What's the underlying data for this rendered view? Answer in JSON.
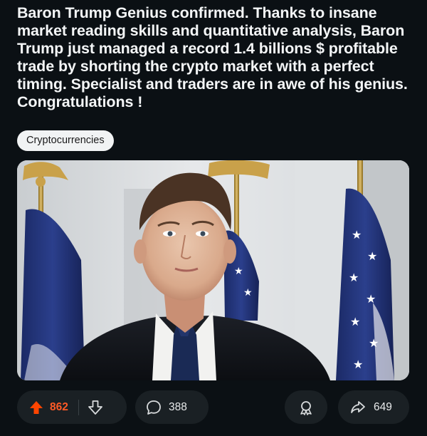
{
  "post": {
    "title": "Baron Trump Genius confirmed. Thanks to insane market reading skills and quantitative analysis, Baron Trump just managed a record 1.4 billions $ profitable trade by shorting the crypto market with a perfect timing. Specialist and traders are in awe of his genius. Congratulations !",
    "flair": "Cryptocurrencies"
  },
  "actions": {
    "upvotes": "862",
    "comments": "388",
    "shares": "649"
  },
  "icons": {
    "upvote": "arrow-up-icon",
    "downvote": "arrow-down-icon",
    "comment": "speech-bubble-icon",
    "award": "award-icon",
    "share": "share-arrow-icon"
  },
  "colors": {
    "background": "#0b1014",
    "upvote_active": "#ff4500",
    "pill": "#1a2024",
    "flair_bg": "#f1f3f4"
  }
}
